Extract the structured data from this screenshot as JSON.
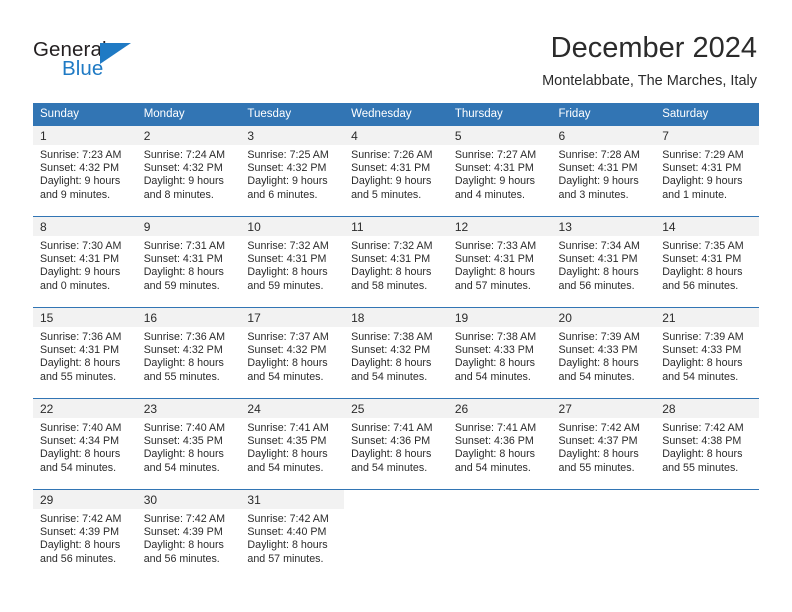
{
  "brand": {
    "name_top": "General",
    "name_bottom": "Blue",
    "accent_color": "#1f7ac4"
  },
  "header": {
    "title": "December 2024",
    "location": "Montelabbate, The Marches, Italy"
  },
  "theme": {
    "header_blue": "#3275b4",
    "daynum_band": "#f2f2f2",
    "text": "#2b2b2b"
  },
  "weekdays": [
    "Sunday",
    "Monday",
    "Tuesday",
    "Wednesday",
    "Thursday",
    "Friday",
    "Saturday"
  ],
  "weeks": [
    [
      {
        "day": "1",
        "sunrise": "Sunrise: 7:23 AM",
        "sunset": "Sunset: 4:32 PM",
        "daylight1": "Daylight: 9 hours",
        "daylight2": "and 9 minutes."
      },
      {
        "day": "2",
        "sunrise": "Sunrise: 7:24 AM",
        "sunset": "Sunset: 4:32 PM",
        "daylight1": "Daylight: 9 hours",
        "daylight2": "and 8 minutes."
      },
      {
        "day": "3",
        "sunrise": "Sunrise: 7:25 AM",
        "sunset": "Sunset: 4:32 PM",
        "daylight1": "Daylight: 9 hours",
        "daylight2": "and 6 minutes."
      },
      {
        "day": "4",
        "sunrise": "Sunrise: 7:26 AM",
        "sunset": "Sunset: 4:31 PM",
        "daylight1": "Daylight: 9 hours",
        "daylight2": "and 5 minutes."
      },
      {
        "day": "5",
        "sunrise": "Sunrise: 7:27 AM",
        "sunset": "Sunset: 4:31 PM",
        "daylight1": "Daylight: 9 hours",
        "daylight2": "and 4 minutes."
      },
      {
        "day": "6",
        "sunrise": "Sunrise: 7:28 AM",
        "sunset": "Sunset: 4:31 PM",
        "daylight1": "Daylight: 9 hours",
        "daylight2": "and 3 minutes."
      },
      {
        "day": "7",
        "sunrise": "Sunrise: 7:29 AM",
        "sunset": "Sunset: 4:31 PM",
        "daylight1": "Daylight: 9 hours",
        "daylight2": "and 1 minute."
      }
    ],
    [
      {
        "day": "8",
        "sunrise": "Sunrise: 7:30 AM",
        "sunset": "Sunset: 4:31 PM",
        "daylight1": "Daylight: 9 hours",
        "daylight2": "and 0 minutes."
      },
      {
        "day": "9",
        "sunrise": "Sunrise: 7:31 AM",
        "sunset": "Sunset: 4:31 PM",
        "daylight1": "Daylight: 8 hours",
        "daylight2": "and 59 minutes."
      },
      {
        "day": "10",
        "sunrise": "Sunrise: 7:32 AM",
        "sunset": "Sunset: 4:31 PM",
        "daylight1": "Daylight: 8 hours",
        "daylight2": "and 59 minutes."
      },
      {
        "day": "11",
        "sunrise": "Sunrise: 7:32 AM",
        "sunset": "Sunset: 4:31 PM",
        "daylight1": "Daylight: 8 hours",
        "daylight2": "and 58 minutes."
      },
      {
        "day": "12",
        "sunrise": "Sunrise: 7:33 AM",
        "sunset": "Sunset: 4:31 PM",
        "daylight1": "Daylight: 8 hours",
        "daylight2": "and 57 minutes."
      },
      {
        "day": "13",
        "sunrise": "Sunrise: 7:34 AM",
        "sunset": "Sunset: 4:31 PM",
        "daylight1": "Daylight: 8 hours",
        "daylight2": "and 56 minutes."
      },
      {
        "day": "14",
        "sunrise": "Sunrise: 7:35 AM",
        "sunset": "Sunset: 4:31 PM",
        "daylight1": "Daylight: 8 hours",
        "daylight2": "and 56 minutes."
      }
    ],
    [
      {
        "day": "15",
        "sunrise": "Sunrise: 7:36 AM",
        "sunset": "Sunset: 4:31 PM",
        "daylight1": "Daylight: 8 hours",
        "daylight2": "and 55 minutes."
      },
      {
        "day": "16",
        "sunrise": "Sunrise: 7:36 AM",
        "sunset": "Sunset: 4:32 PM",
        "daylight1": "Daylight: 8 hours",
        "daylight2": "and 55 minutes."
      },
      {
        "day": "17",
        "sunrise": "Sunrise: 7:37 AM",
        "sunset": "Sunset: 4:32 PM",
        "daylight1": "Daylight: 8 hours",
        "daylight2": "and 54 minutes."
      },
      {
        "day": "18",
        "sunrise": "Sunrise: 7:38 AM",
        "sunset": "Sunset: 4:32 PM",
        "daylight1": "Daylight: 8 hours",
        "daylight2": "and 54 minutes."
      },
      {
        "day": "19",
        "sunrise": "Sunrise: 7:38 AM",
        "sunset": "Sunset: 4:33 PM",
        "daylight1": "Daylight: 8 hours",
        "daylight2": "and 54 minutes."
      },
      {
        "day": "20",
        "sunrise": "Sunrise: 7:39 AM",
        "sunset": "Sunset: 4:33 PM",
        "daylight1": "Daylight: 8 hours",
        "daylight2": "and 54 minutes."
      },
      {
        "day": "21",
        "sunrise": "Sunrise: 7:39 AM",
        "sunset": "Sunset: 4:33 PM",
        "daylight1": "Daylight: 8 hours",
        "daylight2": "and 54 minutes."
      }
    ],
    [
      {
        "day": "22",
        "sunrise": "Sunrise: 7:40 AM",
        "sunset": "Sunset: 4:34 PM",
        "daylight1": "Daylight: 8 hours",
        "daylight2": "and 54 minutes."
      },
      {
        "day": "23",
        "sunrise": "Sunrise: 7:40 AM",
        "sunset": "Sunset: 4:35 PM",
        "daylight1": "Daylight: 8 hours",
        "daylight2": "and 54 minutes."
      },
      {
        "day": "24",
        "sunrise": "Sunrise: 7:41 AM",
        "sunset": "Sunset: 4:35 PM",
        "daylight1": "Daylight: 8 hours",
        "daylight2": "and 54 minutes."
      },
      {
        "day": "25",
        "sunrise": "Sunrise: 7:41 AM",
        "sunset": "Sunset: 4:36 PM",
        "daylight1": "Daylight: 8 hours",
        "daylight2": "and 54 minutes."
      },
      {
        "day": "26",
        "sunrise": "Sunrise: 7:41 AM",
        "sunset": "Sunset: 4:36 PM",
        "daylight1": "Daylight: 8 hours",
        "daylight2": "and 54 minutes."
      },
      {
        "day": "27",
        "sunrise": "Sunrise: 7:42 AM",
        "sunset": "Sunset: 4:37 PM",
        "daylight1": "Daylight: 8 hours",
        "daylight2": "and 55 minutes."
      },
      {
        "day": "28",
        "sunrise": "Sunrise: 7:42 AM",
        "sunset": "Sunset: 4:38 PM",
        "daylight1": "Daylight: 8 hours",
        "daylight2": "and 55 minutes."
      }
    ],
    [
      {
        "day": "29",
        "sunrise": "Sunrise: 7:42 AM",
        "sunset": "Sunset: 4:39 PM",
        "daylight1": "Daylight: 8 hours",
        "daylight2": "and 56 minutes."
      },
      {
        "day": "30",
        "sunrise": "Sunrise: 7:42 AM",
        "sunset": "Sunset: 4:39 PM",
        "daylight1": "Daylight: 8 hours",
        "daylight2": "and 56 minutes."
      },
      {
        "day": "31",
        "sunrise": "Sunrise: 7:42 AM",
        "sunset": "Sunset: 4:40 PM",
        "daylight1": "Daylight: 8 hours",
        "daylight2": "and 57 minutes."
      },
      {
        "day": "",
        "sunrise": "",
        "sunset": "",
        "daylight1": "",
        "daylight2": ""
      },
      {
        "day": "",
        "sunrise": "",
        "sunset": "",
        "daylight1": "",
        "daylight2": ""
      },
      {
        "day": "",
        "sunrise": "",
        "sunset": "",
        "daylight1": "",
        "daylight2": ""
      },
      {
        "day": "",
        "sunrise": "",
        "sunset": "",
        "daylight1": "",
        "daylight2": ""
      }
    ]
  ]
}
